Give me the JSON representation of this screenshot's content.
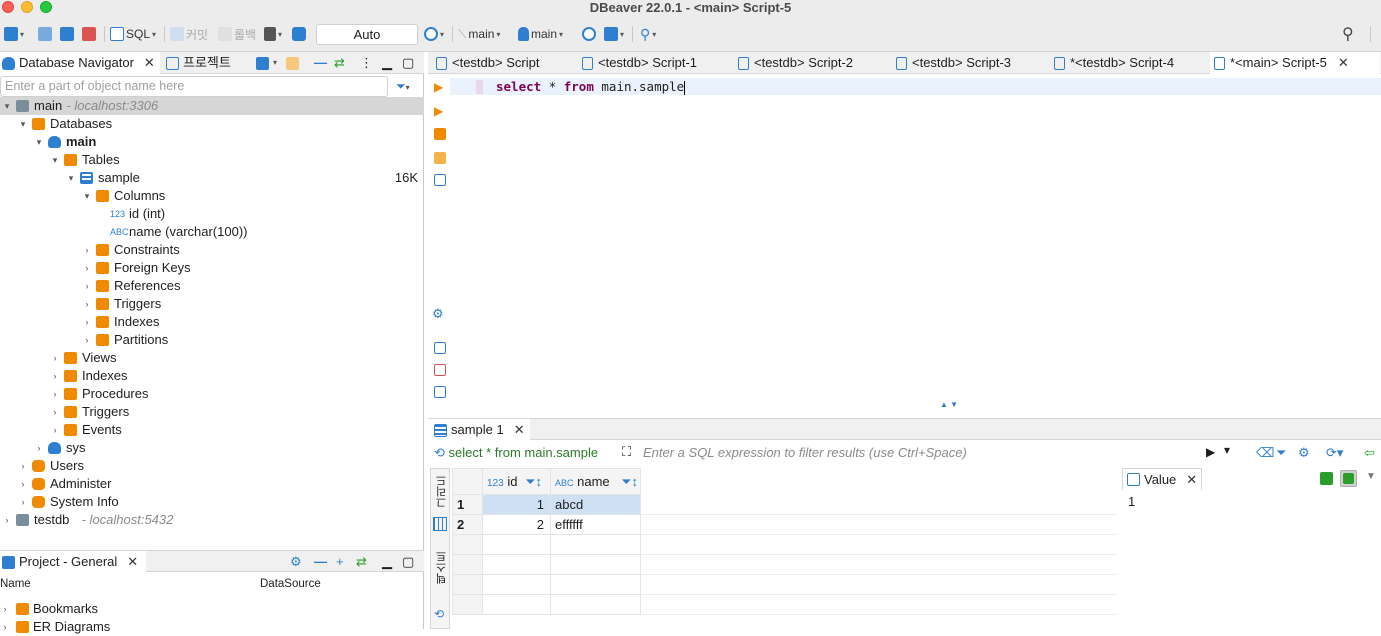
{
  "window": {
    "title": "DBeaver 22.0.1 - <main> Script-5"
  },
  "toolbar": {
    "sql_label": "SQL",
    "commit_label": "커밋",
    "rollback_label": "롤백",
    "tx_mode": "Auto",
    "datasource_label": "main",
    "schema_label": "main"
  },
  "navigator": {
    "tab_label": "Database Navigator",
    "project_tab_label": "프로젝트",
    "filter_placeholder": "Enter a part of object name here",
    "tree": [
      {
        "label": "main",
        "extra": " - localhost:3306",
        "level": 0,
        "arrow": "▾",
        "icon": "connection-icon",
        "selected": true
      },
      {
        "label": "Databases",
        "level": 1,
        "arrow": "▾",
        "icon": "folder-icon"
      },
      {
        "label": "main",
        "level": 2,
        "arrow": "▾",
        "icon": "database-icon",
        "bold": true
      },
      {
        "label": "Tables",
        "level": 3,
        "arrow": "▾",
        "icon": "folder-icon"
      },
      {
        "label": "sample",
        "level": 4,
        "arrow": "▾",
        "icon": "table-icon",
        "size": "16K"
      },
      {
        "label": "Columns",
        "level": 5,
        "arrow": "▾",
        "icon": "folder-icon"
      },
      {
        "label": "id (int)",
        "level": 6,
        "arrow": "",
        "icon": "number-column-icon",
        "prefix": "123"
      },
      {
        "label": "name (varchar(100))",
        "level": 6,
        "arrow": "",
        "icon": "text-column-icon",
        "prefix": "ABC"
      },
      {
        "label": "Constraints",
        "level": 5,
        "arrow": "›",
        "icon": "folder-icon"
      },
      {
        "label": "Foreign Keys",
        "level": 5,
        "arrow": "›",
        "icon": "folder-icon"
      },
      {
        "label": "References",
        "level": 5,
        "arrow": "›",
        "icon": "folder-icon"
      },
      {
        "label": "Triggers",
        "level": 5,
        "arrow": "›",
        "icon": "folder-icon"
      },
      {
        "label": "Indexes",
        "level": 5,
        "arrow": "›",
        "icon": "folder-icon"
      },
      {
        "label": "Partitions",
        "level": 5,
        "arrow": "›",
        "icon": "folder-icon"
      },
      {
        "label": "Views",
        "level": 3,
        "arrow": "›",
        "icon": "folder-icon"
      },
      {
        "label": "Indexes",
        "level": 3,
        "arrow": "›",
        "icon": "folder-icon"
      },
      {
        "label": "Procedures",
        "level": 3,
        "arrow": "›",
        "icon": "folder-icon"
      },
      {
        "label": "Triggers",
        "level": 3,
        "arrow": "›",
        "icon": "folder-icon"
      },
      {
        "label": "Events",
        "level": 3,
        "arrow": "›",
        "icon": "folder-icon"
      },
      {
        "label": "sys",
        "level": 2,
        "arrow": "›",
        "icon": "database-icon"
      },
      {
        "label": "Users",
        "level": 1,
        "arrow": "›",
        "icon": "users-icon"
      },
      {
        "label": "Administer",
        "level": 1,
        "arrow": "›",
        "icon": "administer-icon"
      },
      {
        "label": "System Info",
        "level": 1,
        "arrow": "›",
        "icon": "system-info-icon"
      },
      {
        "label": "testdb",
        "extra": " - localhost:5432",
        "level": 0,
        "arrow": "›",
        "icon": "connection-icon"
      }
    ]
  },
  "project": {
    "tab_label": "Project - General",
    "col_name": "Name",
    "col_datasource": "DataSource",
    "rows": [
      {
        "label": "Bookmarks"
      },
      {
        "label": "ER Diagrams"
      }
    ]
  },
  "editor": {
    "tabs": [
      {
        "label": "<testdb> Script",
        "active": false
      },
      {
        "label": "<testdb> Script-1",
        "active": false
      },
      {
        "label": "<testdb> Script-2",
        "active": false
      },
      {
        "label": "<testdb> Script-3",
        "active": false
      },
      {
        "label": "*<testdb> Script-4",
        "active": false
      },
      {
        "label": "*<main> Script-5",
        "active": true
      }
    ],
    "code": {
      "kw1": "select",
      "star": "*",
      "kw2": "from",
      "rest": "main.sample"
    }
  },
  "results": {
    "tab_label": "sample 1",
    "query_label": "select * from main.sample",
    "filter_placeholder": "Enter a SQL expression to filter results (use Ctrl+Space)",
    "side_grid_label": "그리드",
    "side_text_label": "텍스트",
    "columns": [
      {
        "name": "id",
        "type_prefix": "123"
      },
      {
        "name": "name",
        "type_prefix": "ABC"
      }
    ],
    "rows": [
      {
        "num": "1",
        "id": "1",
        "name": "abcd"
      },
      {
        "num": "2",
        "id": "2",
        "name": "effffff"
      }
    ],
    "value_panel": {
      "tab_label": "Value",
      "value": "1"
    }
  }
}
